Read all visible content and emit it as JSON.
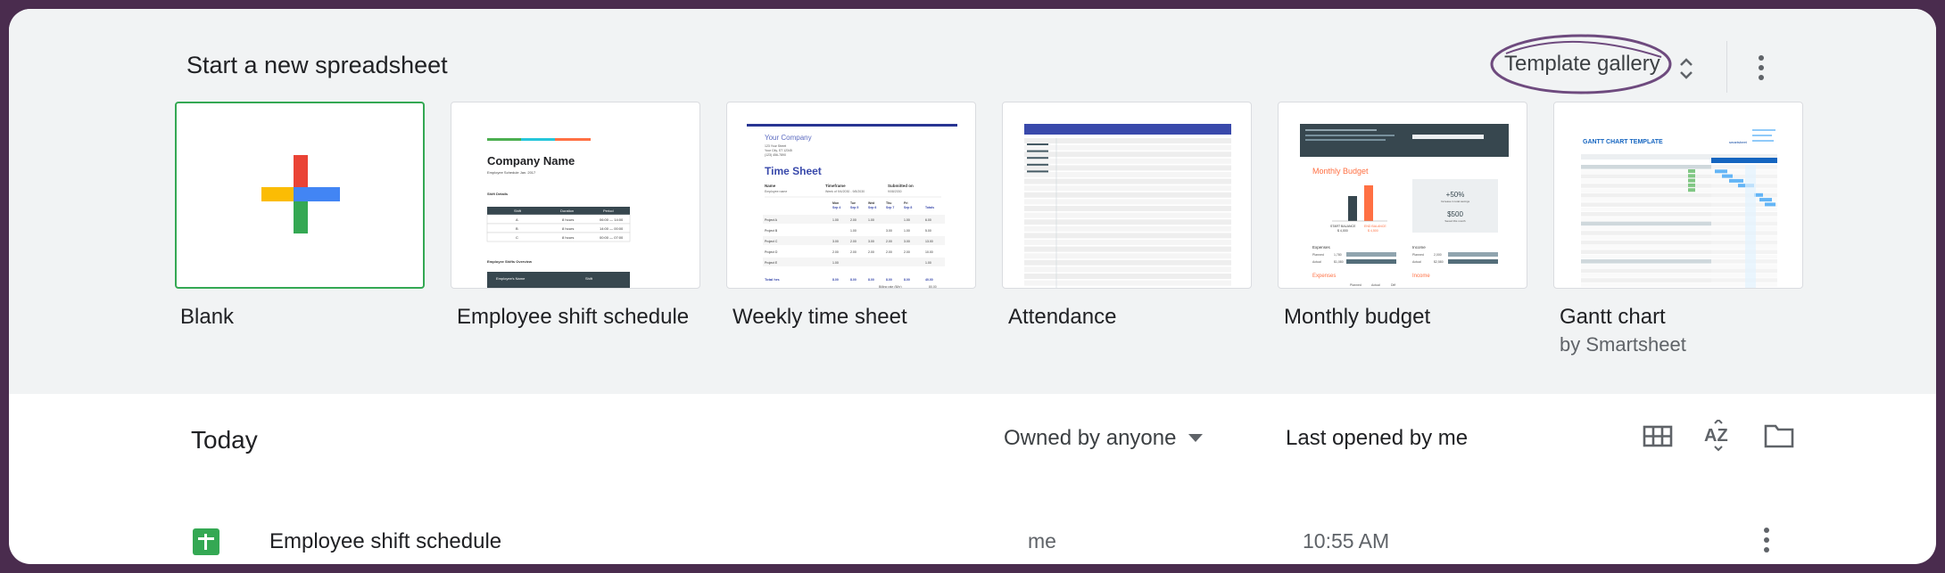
{
  "header": {
    "title": "Start a new spreadsheet",
    "gallery_label": "Template gallery"
  },
  "templates": [
    {
      "label": "Blank",
      "sub": ""
    },
    {
      "label": "Employee shift schedule",
      "sub": ""
    },
    {
      "label": "Weekly time sheet",
      "sub": ""
    },
    {
      "label": "Attendance",
      "sub": ""
    },
    {
      "label": "Monthly budget",
      "sub": ""
    },
    {
      "label": "Gantt chart",
      "sub": "by Smartsheet"
    }
  ],
  "thumbs": {
    "shift": {
      "title": "Company Name",
      "subtitle": "Employee Schedule Jan. 2017",
      "section1": "Shift Details",
      "headers": [
        "Shift",
        "Duration",
        "Period"
      ],
      "rows": [
        [
          "A",
          "8 hours",
          "06:00 — 14:00"
        ],
        [
          "B",
          "8 hours",
          "14:00 — 00:00"
        ],
        [
          "C",
          "8 hours",
          "00:00 — 07:00"
        ]
      ],
      "section2": "Employee Shifts Overview",
      "footer_headers": [
        "Employee's Name",
        "Shift"
      ]
    },
    "timesheet": {
      "company": "Your Company",
      "address": [
        "123 Your Street",
        "Your City, ST 12345",
        "(123) 456-7890"
      ],
      "title": "Time Sheet",
      "col_name": "Name",
      "col_timeframe": "Timeframe",
      "col_submitted": "Submitted on",
      "name_val": "Employee name",
      "timeframe_val": "Week of 9/4/2030 - 9/8/2030",
      "submitted_val": "9/08/2030",
      "days": [
        "Mon",
        "Tue",
        "Wed",
        "Thu",
        "Fri"
      ],
      "dates": [
        "Sep 4",
        "Sep 5",
        "Sep 6",
        "Sep 7",
        "Sep 8"
      ],
      "totals_label": "Totals",
      "projects": [
        "Project A",
        "Project B",
        "Project C",
        "Project D",
        "Project E"
      ],
      "project_values": [
        [
          "1.00",
          "2.00",
          "1.00",
          "",
          "1.00",
          "6.00"
        ],
        [
          "",
          "1.00",
          "",
          "3.00",
          "1.00",
          "5.00"
        ],
        [
          "3.00",
          "2.00",
          "3.00",
          "2.00",
          "3.00",
          "13.00"
        ],
        [
          "2.00",
          "2.00",
          "2.00",
          "2.00",
          "2.00",
          "10.00"
        ],
        [
          "1.00",
          "",
          "",
          "",
          "",
          "1.00"
        ]
      ],
      "total_hours_label": "Total hrs",
      "total_values": [
        "8.00",
        "8.00",
        "8.00",
        "8.00",
        "8.00",
        "40.00"
      ],
      "billing_label": "Billing rate ($/hr)",
      "billing_value": "80.00"
    },
    "budget": {
      "heading": "Monthly Budget",
      "start_label": "START BALANCE",
      "start_value": "$ 4,000",
      "end_label": "END BALANCE",
      "end_value": "$ 4,500",
      "pct": "+50%",
      "pct_caption": "Increase in total savings",
      "saved": "$500",
      "saved_caption": "Saved this month",
      "expenses_label": "Expenses",
      "income_label": "Income",
      "planned_label": "Planned",
      "actual_label": "Actual",
      "planned_val": "1,780",
      "actual_val": "$1,080",
      "income_planned": "2,000",
      "income_actual": "$2,580",
      "diff_label": "Diff"
    },
    "gantt": {
      "title": "GANTT CHART TEMPLATE",
      "brand": "smartsheet"
    }
  },
  "list": {
    "title": "Today",
    "owner_filter": "Owned by anyone",
    "sort_label": "Last opened by me"
  },
  "files": [
    {
      "name": "Employee shift schedule",
      "owner": "me",
      "time": "10:55 AM"
    }
  ],
  "colors": {
    "background": "#f1f3f4",
    "frame": "#4a2c4e",
    "accent_green": "#34a853",
    "circle": "#6e4a7e",
    "timesheet_blue": "#3949ab"
  }
}
